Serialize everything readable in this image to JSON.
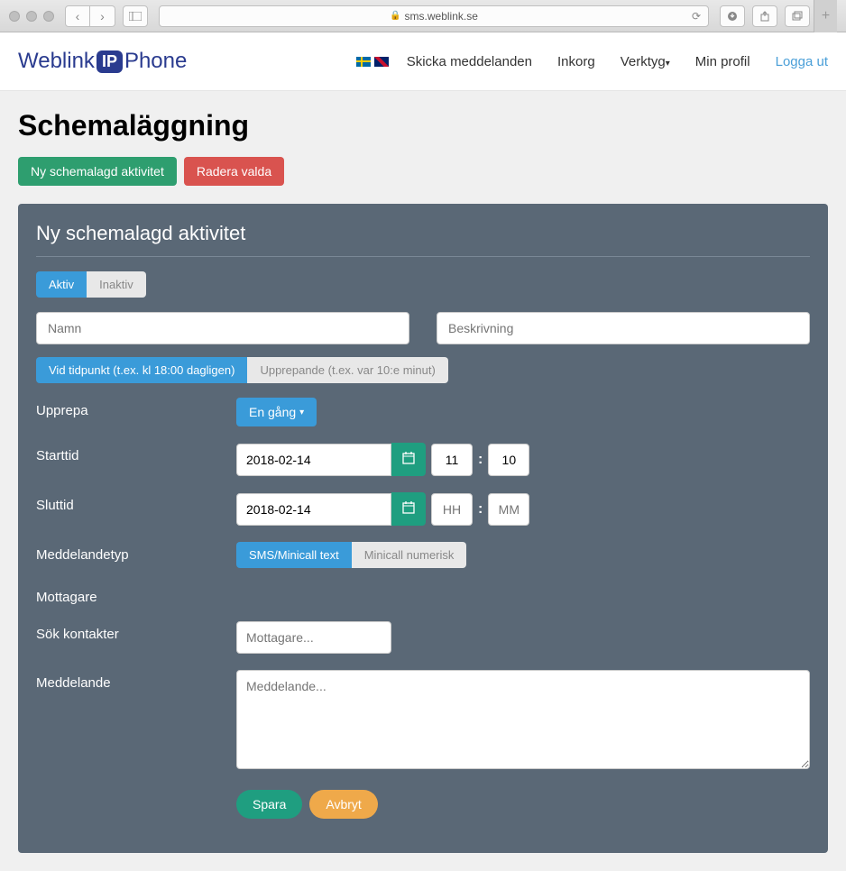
{
  "browser": {
    "url": "sms.weblink.se"
  },
  "logo": {
    "part1": "Weblink",
    "badge": "IP",
    "part2": "Phone"
  },
  "nav": {
    "send": "Skicka meddelanden",
    "inbox": "Inkorg",
    "tools": "Verktyg",
    "profile": "Min profil",
    "logout": "Logga ut"
  },
  "page": {
    "title": "Schemaläggning",
    "new_activity": "Ny schemalagd aktivitet",
    "delete_selected": "Radera valda"
  },
  "panel": {
    "title": "Ny schemalagd aktivitet",
    "active": "Aktiv",
    "inactive": "Inaktiv",
    "name_placeholder": "Namn",
    "desc_placeholder": "Beskrivning",
    "timing_at": "Vid tidpunkt (t.ex. kl 18:00 dagligen)",
    "timing_repeat": "Upprepande (t.ex. var 10:e minut)",
    "repeat_label": "Upprepa",
    "repeat_value": "En gång",
    "start_label": "Starttid",
    "start_date": "2018-02-14",
    "start_hh": "11",
    "start_mm": "10",
    "end_label": "Sluttid",
    "end_date": "2018-02-14",
    "end_hh_placeholder": "HH",
    "end_mm_placeholder": "MM",
    "msgtype_label": "Meddelandetyp",
    "msgtype_sms": "SMS/Minicall text",
    "msgtype_num": "Minicall numerisk",
    "recipients_label": "Mottagare",
    "search_label": "Sök kontakter",
    "search_placeholder": "Mottagare...",
    "message_label": "Meddelande",
    "message_placeholder": "Meddelande...",
    "save": "Spara",
    "cancel": "Avbryt"
  }
}
